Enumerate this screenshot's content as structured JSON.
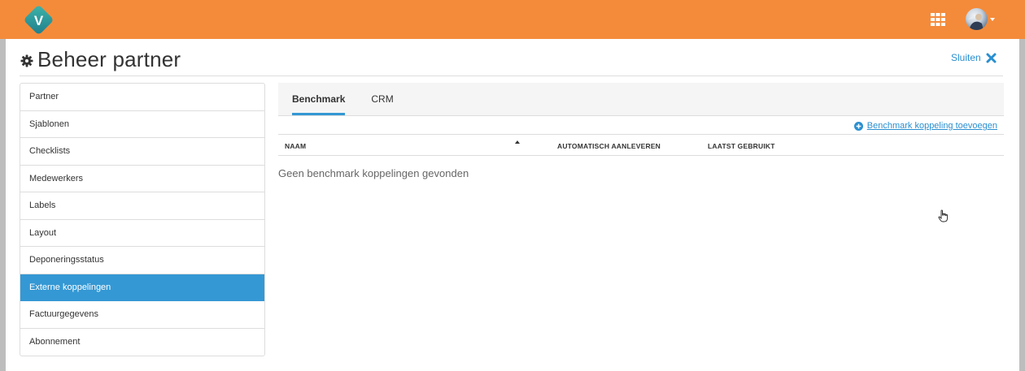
{
  "header": {
    "logo_letter": "V",
    "brand_color": "#f48b3a",
    "apps_icon": "grid-icon",
    "avatar_icon": "user-avatar"
  },
  "page": {
    "title": "Beheer partner",
    "title_icon": "gear-icon",
    "close_label": "Sluiten",
    "close_icon": "close-x-icon"
  },
  "sidebar": {
    "items": [
      {
        "label": "Partner"
      },
      {
        "label": "Sjablonen"
      },
      {
        "label": "Checklists"
      },
      {
        "label": "Medewerkers"
      },
      {
        "label": "Labels"
      },
      {
        "label": "Layout"
      },
      {
        "label": "Deponeringsstatus"
      },
      {
        "label": "Externe koppelingen",
        "active": true
      },
      {
        "label": "Factuurgegevens"
      },
      {
        "label": "Abonnement"
      }
    ],
    "active_color": "#3498d4"
  },
  "main": {
    "tabs": [
      {
        "label": "Benchmark",
        "active": true
      },
      {
        "label": "CRM"
      }
    ],
    "add_link": "Benchmark koppeling toevoegen",
    "table": {
      "columns": [
        "NAAM",
        "AUTOMATISCH AANLEVEREN",
        "LAATST GEBRUIKT"
      ],
      "sorted_column": "NAAM",
      "sort_direction": "ascending"
    },
    "empty_message": "Geen benchmark koppelingen gevonden"
  }
}
